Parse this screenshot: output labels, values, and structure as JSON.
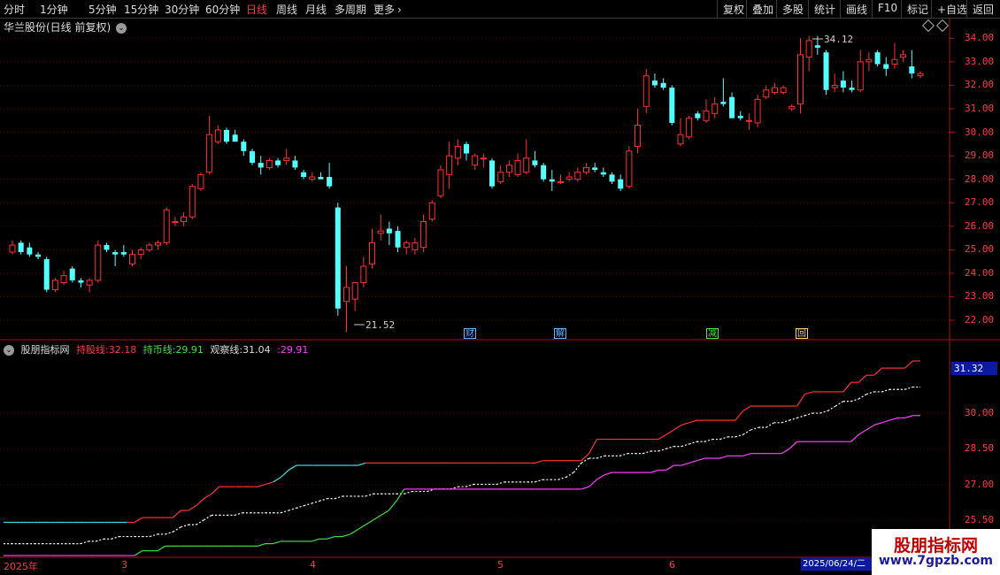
{
  "toolbar": {
    "periods": [
      "分时",
      "1分钟",
      "5分钟",
      "15分钟",
      "30分钟",
      "60分钟",
      "日线",
      "周线",
      "月线",
      "多周期"
    ],
    "active": "日线",
    "more": "更多",
    "more_icon": "chevron-right-icon",
    "right_buttons": [
      "复权",
      "叠加",
      "多股",
      "统计",
      "画线",
      "F10",
      "标记",
      "+自选",
      "返回"
    ]
  },
  "chart": {
    "title": "华兰股份(日线 前复权)",
    "high_label": "34.12",
    "low_label": "21.52",
    "y_ticks": [
      "34.00",
      "33.00",
      "32.00",
      "31.00",
      "30.00",
      "29.00",
      "28.00",
      "27.00",
      "26.00",
      "25.00",
      "24.00",
      "23.00",
      "22.00"
    ],
    "events": [
      {
        "label": "财",
        "color": "#5ab4ff"
      },
      {
        "label": "解",
        "color": "#5ab4ff"
      },
      {
        "label": "减",
        "color": "#48e048"
      },
      {
        "label": "回",
        "color": "#ffd070"
      }
    ]
  },
  "indicator": {
    "name": "股朋指标网",
    "line1_label": "持股线:",
    "line1_value": "32.18",
    "line2_label": "持币线:",
    "line2_value": "29.91",
    "line3_label": "观察线:",
    "line3_value": "31.04",
    "line4_value": ":29.91",
    "y_ticks": [
      "30.00",
      "28.50",
      "27.00",
      "25.50"
    ],
    "current_value": "31.32"
  },
  "dates": {
    "labels": [
      "2025年",
      "3",
      "4",
      "5",
      "6"
    ],
    "current": "2025/06/24/二"
  },
  "watermark": {
    "title": "股朋指标网",
    "url": "www.7gpzb.com"
  },
  "colors": {
    "up": "#ff3232",
    "down": "#54ffff",
    "magenta": "#ff40ff",
    "green": "#40e040",
    "white": "#ffffff"
  },
  "chart_data": {
    "type": "candlestick",
    "title": "华兰股份(日线 前复权)",
    "ylim": [
      21.4,
      34.5
    ],
    "candles": [
      {
        "o": 24.9,
        "h": 25.4,
        "l": 24.8,
        "c": 25.2
      },
      {
        "o": 25.3,
        "h": 25.4,
        "l": 24.8,
        "c": 24.9
      },
      {
        "o": 25.1,
        "h": 25.3,
        "l": 24.7,
        "c": 24.8
      },
      {
        "o": 24.8,
        "h": 24.9,
        "l": 24.6,
        "c": 24.7
      },
      {
        "o": 24.6,
        "h": 24.7,
        "l": 23.2,
        "c": 23.3
      },
      {
        "o": 23.3,
        "h": 23.8,
        "l": 23.2,
        "c": 23.7
      },
      {
        "o": 23.6,
        "h": 24.1,
        "l": 23.5,
        "c": 23.9
      },
      {
        "o": 24.2,
        "h": 24.3,
        "l": 23.6,
        "c": 23.7
      },
      {
        "o": 23.7,
        "h": 23.8,
        "l": 23.4,
        "c": 23.6
      },
      {
        "o": 23.5,
        "h": 23.8,
        "l": 23.2,
        "c": 23.7
      },
      {
        "o": 23.7,
        "h": 25.4,
        "l": 23.6,
        "c": 25.2
      },
      {
        "o": 25.2,
        "h": 25.3,
        "l": 24.9,
        "c": 25.0
      },
      {
        "o": 24.9,
        "h": 25.0,
        "l": 24.3,
        "c": 24.8
      },
      {
        "o": 24.9,
        "h": 25.2,
        "l": 24.7,
        "c": 24.8
      },
      {
        "o": 24.4,
        "h": 25.0,
        "l": 24.3,
        "c": 24.8
      },
      {
        "o": 24.8,
        "h": 25.1,
        "l": 24.6,
        "c": 25.0
      },
      {
        "o": 25.0,
        "h": 25.3,
        "l": 24.9,
        "c": 25.2
      },
      {
        "o": 25.2,
        "h": 25.4,
        "l": 25.0,
        "c": 25.3
      },
      {
        "o": 25.3,
        "h": 26.8,
        "l": 25.2,
        "c": 26.7
      },
      {
        "o": 26.2,
        "h": 26.4,
        "l": 26.0,
        "c": 26.2
      },
      {
        "o": 26.2,
        "h": 26.6,
        "l": 26.0,
        "c": 26.4
      },
      {
        "o": 26.4,
        "h": 27.8,
        "l": 26.3,
        "c": 27.7
      },
      {
        "o": 27.6,
        "h": 28.3,
        "l": 27.5,
        "c": 28.2
      },
      {
        "o": 28.3,
        "h": 30.7,
        "l": 28.2,
        "c": 29.9
      },
      {
        "o": 29.6,
        "h": 30.3,
        "l": 29.5,
        "c": 30.1
      },
      {
        "o": 30.1,
        "h": 30.2,
        "l": 29.5,
        "c": 29.6
      },
      {
        "o": 29.9,
        "h": 30.1,
        "l": 29.6,
        "c": 29.6
      },
      {
        "o": 29.6,
        "h": 29.7,
        "l": 29.0,
        "c": 29.2
      },
      {
        "o": 29.2,
        "h": 29.3,
        "l": 28.6,
        "c": 28.7
      },
      {
        "o": 28.7,
        "h": 29.0,
        "l": 28.2,
        "c": 28.5
      },
      {
        "o": 28.5,
        "h": 28.9,
        "l": 28.4,
        "c": 28.8
      },
      {
        "o": 28.8,
        "h": 28.9,
        "l": 28.5,
        "c": 28.6
      },
      {
        "o": 28.8,
        "h": 29.3,
        "l": 28.6,
        "c": 28.9
      },
      {
        "o": 28.8,
        "h": 29.0,
        "l": 28.4,
        "c": 28.5
      },
      {
        "o": 28.3,
        "h": 28.4,
        "l": 28.0,
        "c": 28.1
      },
      {
        "o": 28.0,
        "h": 28.3,
        "l": 27.9,
        "c": 28.1
      },
      {
        "o": 28.1,
        "h": 28.3,
        "l": 28.0,
        "c": 28.0
      },
      {
        "o": 28.1,
        "h": 28.7,
        "l": 27.6,
        "c": 27.7
      },
      {
        "o": 26.8,
        "h": 27.0,
        "l": 22.2,
        "c": 22.5
      },
      {
        "o": 22.8,
        "h": 24.3,
        "l": 21.5,
        "c": 23.4
      },
      {
        "o": 22.9,
        "h": 23.4,
        "l": 22.4,
        "c": 23.6
      },
      {
        "o": 23.6,
        "h": 24.7,
        "l": 23.4,
        "c": 24.3
      },
      {
        "o": 24.4,
        "h": 25.9,
        "l": 24.2,
        "c": 25.3
      },
      {
        "o": 25.7,
        "h": 26.5,
        "l": 25.4,
        "c": 25.8
      },
      {
        "o": 25.9,
        "h": 26.2,
        "l": 25.2,
        "c": 25.7
      },
      {
        "o": 25.8,
        "h": 26.0,
        "l": 24.9,
        "c": 25.1
      },
      {
        "o": 25.1,
        "h": 25.4,
        "l": 24.8,
        "c": 25.3
      },
      {
        "o": 25.0,
        "h": 25.5,
        "l": 24.8,
        "c": 25.3
      },
      {
        "o": 25.1,
        "h": 26.5,
        "l": 24.9,
        "c": 26.2
      },
      {
        "o": 26.3,
        "h": 27.1,
        "l": 26.2,
        "c": 27.0
      },
      {
        "o": 27.3,
        "h": 28.6,
        "l": 27.2,
        "c": 28.4
      },
      {
        "o": 28.2,
        "h": 29.6,
        "l": 27.6,
        "c": 29.0
      },
      {
        "o": 28.9,
        "h": 29.7,
        "l": 28.6,
        "c": 29.4
      },
      {
        "o": 29.5,
        "h": 29.6,
        "l": 28.8,
        "c": 29.1
      },
      {
        "o": 28.6,
        "h": 29.1,
        "l": 28.4,
        "c": 29.0
      },
      {
        "o": 28.9,
        "h": 29.1,
        "l": 28.5,
        "c": 28.9
      },
      {
        "o": 28.8,
        "h": 28.9,
        "l": 27.6,
        "c": 27.7
      },
      {
        "o": 27.9,
        "h": 28.6,
        "l": 27.8,
        "c": 28.3
      },
      {
        "o": 28.3,
        "h": 28.8,
        "l": 28.1,
        "c": 28.6
      },
      {
        "o": 28.2,
        "h": 29.1,
        "l": 28.1,
        "c": 28.8
      },
      {
        "o": 28.3,
        "h": 29.7,
        "l": 28.2,
        "c": 28.9
      },
      {
        "o": 28.8,
        "h": 29.2,
        "l": 28.5,
        "c": 28.6
      },
      {
        "o": 28.6,
        "h": 28.7,
        "l": 27.9,
        "c": 28.0
      },
      {
        "o": 28.0,
        "h": 28.4,
        "l": 27.5,
        "c": 27.9
      },
      {
        "o": 27.9,
        "h": 28.2,
        "l": 27.8,
        "c": 27.9
      },
      {
        "o": 28.0,
        "h": 28.3,
        "l": 27.9,
        "c": 28.1
      },
      {
        "o": 28.0,
        "h": 28.5,
        "l": 27.9,
        "c": 28.3
      },
      {
        "o": 28.3,
        "h": 28.7,
        "l": 28.2,
        "c": 28.5
      },
      {
        "o": 28.5,
        "h": 28.7,
        "l": 28.3,
        "c": 28.4
      },
      {
        "o": 28.3,
        "h": 28.5,
        "l": 28.1,
        "c": 28.2
      },
      {
        "o": 28.2,
        "h": 28.3,
        "l": 27.8,
        "c": 27.9
      },
      {
        "o": 28.0,
        "h": 28.2,
        "l": 27.5,
        "c": 27.6
      },
      {
        "o": 27.7,
        "h": 29.4,
        "l": 27.6,
        "c": 29.2
      },
      {
        "o": 29.4,
        "h": 31.0,
        "l": 29.1,
        "c": 30.3
      },
      {
        "o": 31.1,
        "h": 32.7,
        "l": 30.8,
        "c": 32.4
      },
      {
        "o": 32.2,
        "h": 32.5,
        "l": 31.9,
        "c": 32.0
      },
      {
        "o": 32.1,
        "h": 32.3,
        "l": 31.8,
        "c": 31.9
      },
      {
        "o": 31.9,
        "h": 32.0,
        "l": 30.3,
        "c": 30.4
      },
      {
        "o": 29.5,
        "h": 30.6,
        "l": 29.4,
        "c": 29.9
      },
      {
        "o": 29.8,
        "h": 30.7,
        "l": 29.7,
        "c": 30.6
      },
      {
        "o": 30.8,
        "h": 30.9,
        "l": 30.5,
        "c": 30.6
      },
      {
        "o": 30.5,
        "h": 31.4,
        "l": 30.4,
        "c": 30.9
      },
      {
        "o": 30.8,
        "h": 31.5,
        "l": 30.6,
        "c": 31.2
      },
      {
        "o": 31.3,
        "h": 32.3,
        "l": 31.1,
        "c": 31.2
      },
      {
        "o": 31.5,
        "h": 31.7,
        "l": 30.6,
        "c": 30.6
      },
      {
        "o": 30.7,
        "h": 30.9,
        "l": 30.5,
        "c": 30.6
      },
      {
        "o": 30.5,
        "h": 30.8,
        "l": 30.1,
        "c": 30.5
      },
      {
        "o": 30.4,
        "h": 31.6,
        "l": 30.2,
        "c": 31.4
      },
      {
        "o": 31.5,
        "h": 32.0,
        "l": 31.4,
        "c": 31.8
      },
      {
        "o": 31.7,
        "h": 32.1,
        "l": 31.6,
        "c": 31.9
      },
      {
        "o": 31.7,
        "h": 32.0,
        "l": 31.6,
        "c": 31.9
      },
      {
        "o": 31.0,
        "h": 31.2,
        "l": 30.9,
        "c": 31.1
      },
      {
        "o": 31.2,
        "h": 34.0,
        "l": 30.8,
        "c": 33.3
      },
      {
        "o": 33.2,
        "h": 34.1,
        "l": 32.6,
        "c": 33.9
      },
      {
        "o": 33.7,
        "h": 34.1,
        "l": 33.3,
        "c": 33.6
      },
      {
        "o": 33.4,
        "h": 33.5,
        "l": 31.6,
        "c": 31.8
      },
      {
        "o": 31.9,
        "h": 32.5,
        "l": 31.7,
        "c": 32.0
      },
      {
        "o": 32.2,
        "h": 32.6,
        "l": 31.7,
        "c": 31.9
      },
      {
        "o": 31.9,
        "h": 32.2,
        "l": 31.7,
        "c": 31.8
      },
      {
        "o": 31.8,
        "h": 33.5,
        "l": 31.7,
        "c": 33.0
      },
      {
        "o": 33.0,
        "h": 33.4,
        "l": 32.6,
        "c": 33.1
      },
      {
        "o": 33.4,
        "h": 33.5,
        "l": 32.8,
        "c": 32.9
      },
      {
        "o": 32.9,
        "h": 33.2,
        "l": 32.4,
        "c": 32.7
      },
      {
        "o": 32.9,
        "h": 33.8,
        "l": 32.7,
        "c": 33.1
      },
      {
        "o": 33.2,
        "h": 33.5,
        "l": 33.0,
        "c": 33.3
      },
      {
        "o": 32.8,
        "h": 33.5,
        "l": 32.3,
        "c": 32.5
      },
      {
        "o": 32.4,
        "h": 32.6,
        "l": 32.3,
        "c": 32.5
      }
    ],
    "indicator_ylim": [
      24.0,
      32.5
    ],
    "hold_line": [
      25.4,
      25.4,
      25.4,
      25.4,
      25.4,
      25.4,
      25.4,
      25.4,
      25.4,
      25.4,
      25.4,
      25.4,
      25.4,
      25.4,
      25.4,
      25.4,
      25.4,
      25.4,
      25.6,
      25.6,
      25.6,
      25.6,
      25.6,
      25.9,
      25.9,
      26.1,
      26.4,
      26.6,
      26.9,
      26.9,
      26.9,
      26.9,
      26.9,
      26.9,
      27.0,
      27.1,
      27.3,
      27.6,
      27.8,
      27.8,
      27.8,
      27.8,
      27.8,
      27.8,
      27.8,
      27.8,
      27.8,
      27.9,
      27.9,
      27.9,
      27.9,
      27.9,
      27.9,
      27.9,
      27.9,
      27.9,
      27.9,
      27.9,
      27.9,
      27.9,
      27.9,
      27.9,
      27.9,
      27.9,
      27.9,
      27.9,
      27.9,
      27.9,
      27.9,
      27.9,
      28.0,
      28.0,
      28.0,
      28.0,
      28.0,
      28.0,
      28.3,
      28.9,
      28.9,
      28.9,
      28.9,
      28.9,
      28.9,
      28.9,
      28.9,
      28.9,
      29.1,
      29.3,
      29.5,
      29.6,
      29.7,
      29.7,
      29.7,
      29.7,
      29.7,
      29.7,
      30.1,
      30.3,
      30.3,
      30.3,
      30.3,
      30.3,
      30.3,
      30.3,
      30.8,
      30.9,
      30.9,
      30.9,
      30.9,
      30.9,
      31.3,
      31.3,
      31.6,
      31.6,
      31.9,
      31.9,
      31.9,
      31.9,
      32.2,
      32.2
    ],
    "watch_line": [
      24.5,
      24.5,
      24.5,
      24.5,
      24.5,
      24.5,
      24.5,
      24.5,
      24.5,
      24.5,
      24.5,
      24.6,
      24.6,
      24.7,
      24.7,
      24.8,
      24.8,
      24.8,
      24.8,
      24.8,
      24.9,
      24.9,
      25.0,
      25.2,
      25.3,
      25.3,
      25.5,
      25.7,
      25.7,
      25.7,
      25.7,
      25.8,
      25.8,
      25.8,
      25.8,
      25.8,
      25.8,
      25.9,
      26.0,
      26.1,
      26.2,
      26.3,
      26.4,
      26.4,
      26.5,
      26.5,
      26.5,
      26.5,
      26.6,
      26.6,
      26.6,
      26.6,
      26.6,
      26.7,
      26.7,
      26.7,
      26.8,
      26.8,
      26.8,
      26.9,
      26.9,
      27.0,
      27.0,
      27.0,
      27.0,
      27.1,
      27.1,
      27.1,
      27.1,
      27.1,
      27.2,
      27.2,
      27.2,
      27.3,
      27.5,
      27.9,
      28.1,
      28.1,
      28.2,
      28.2,
      28.2,
      28.3,
      28.3,
      28.3,
      28.4,
      28.4,
      28.5,
      28.6,
      28.6,
      28.7,
      28.8,
      28.8,
      28.9,
      28.9,
      29.0,
      29.0,
      29.1,
      29.3,
      29.4,
      29.4,
      29.6,
      29.6,
      29.7,
      29.8,
      29.9,
      30.0,
      30.0,
      30.1,
      30.3,
      30.5,
      30.5,
      30.6,
      30.8,
      30.9,
      30.9,
      31.0,
      31.0,
      31.0,
      31.1,
      31.1
    ],
    "cash_line": [
      24.0,
      24.0,
      24.0,
      24.0,
      24.0,
      24.0,
      24.0,
      24.0,
      24.0,
      24.0,
      24.0,
      24.0,
      24.0,
      24.0,
      24.0,
      24.0,
      24.0,
      24.0,
      24.2,
      24.2,
      24.2,
      24.4,
      24.4,
      24.4,
      24.4,
      24.4,
      24.4,
      24.4,
      24.4,
      24.4,
      24.4,
      24.4,
      24.4,
      24.4,
      24.5,
      24.5,
      24.6,
      24.6,
      24.6,
      24.6,
      24.6,
      24.7,
      24.7,
      24.8,
      24.8,
      24.9,
      25.1,
      25.3,
      25.5,
      25.7,
      25.9,
      26.3,
      26.8,
      26.8,
      26.8,
      26.8,
      26.8,
      26.8,
      26.8,
      26.8,
      26.8,
      26.8,
      26.8,
      26.8,
      26.8,
      26.8,
      26.8,
      26.8,
      26.8,
      26.8,
      26.8,
      26.8,
      26.8,
      26.8,
      26.8,
      26.8,
      26.9,
      27.2,
      27.4,
      27.5,
      27.5,
      27.5,
      27.5,
      27.5,
      27.5,
      27.6,
      27.6,
      27.8,
      27.8,
      27.9,
      28.0,
      28.1,
      28.1,
      28.1,
      28.2,
      28.2,
      28.2,
      28.3,
      28.3,
      28.3,
      28.3,
      28.3,
      28.5,
      28.8,
      28.8,
      28.8,
      28.8,
      28.8,
      28.8,
      28.8,
      28.8,
      29.1,
      29.3,
      29.5,
      29.6,
      29.7,
      29.8,
      29.8,
      29.9,
      29.9
    ]
  }
}
